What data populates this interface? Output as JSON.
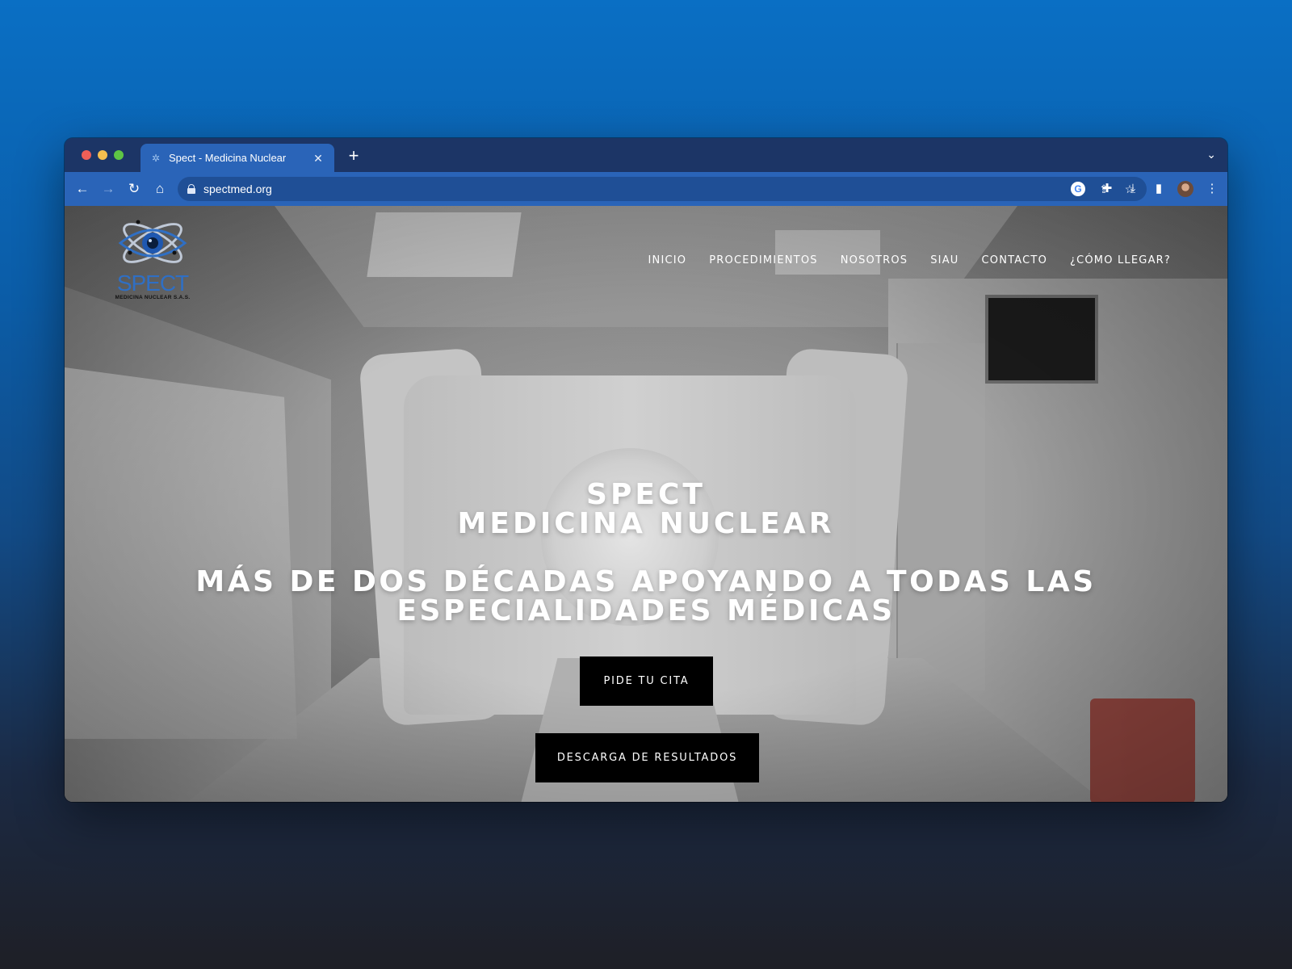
{
  "browser": {
    "tab": {
      "title": "Spect - Medicina Nuclear",
      "favicon": "spect-favicon-icon",
      "close_glyph": "✕"
    },
    "new_tab_glyph": "+",
    "tabs_menu_glyph": "⌄",
    "address": "spectmed.org",
    "nav_glyphs": {
      "back": "←",
      "forward": "→",
      "reload": "↻",
      "home": "⌂"
    },
    "omnibox_icons": {
      "google": "G",
      "share": "⇪",
      "bookmark": "☆"
    },
    "toolbar_icons": {
      "extensions": "✚",
      "download": "⤓",
      "sidepanel": "▮",
      "menu": "⋮"
    }
  },
  "site": {
    "logo": {
      "word": "SPECT",
      "subtitle": "MEDICINA NUCLEAR S.A.S."
    },
    "nav": [
      "INICIO",
      "PROCEDIMIENTOS",
      "NOSOTROS",
      "SIAU",
      "CONTACTO",
      "¿CÓMO LLEGAR?"
    ],
    "hero": {
      "title_line1": "SPECT",
      "title_line2": "MEDICINA NUCLEAR",
      "subtitle_line1": "MÁS DE DOS DÉCADAS APOYANDO A TODAS LAS",
      "subtitle_line2": "ESPECIALIDADES MÉDICAS"
    },
    "buttons": {
      "appointment": "PIDE TU CITA",
      "results": "DESCARGA DE RESULTADOS"
    }
  },
  "colors": {
    "background_top": "#0a6fc4",
    "background_bottom": "#1e1f26",
    "tabstrip": "#1c3566",
    "toolbar": "#2a64b8",
    "logo_blue": "#2f6fc4",
    "button_bg": "#000000"
  }
}
